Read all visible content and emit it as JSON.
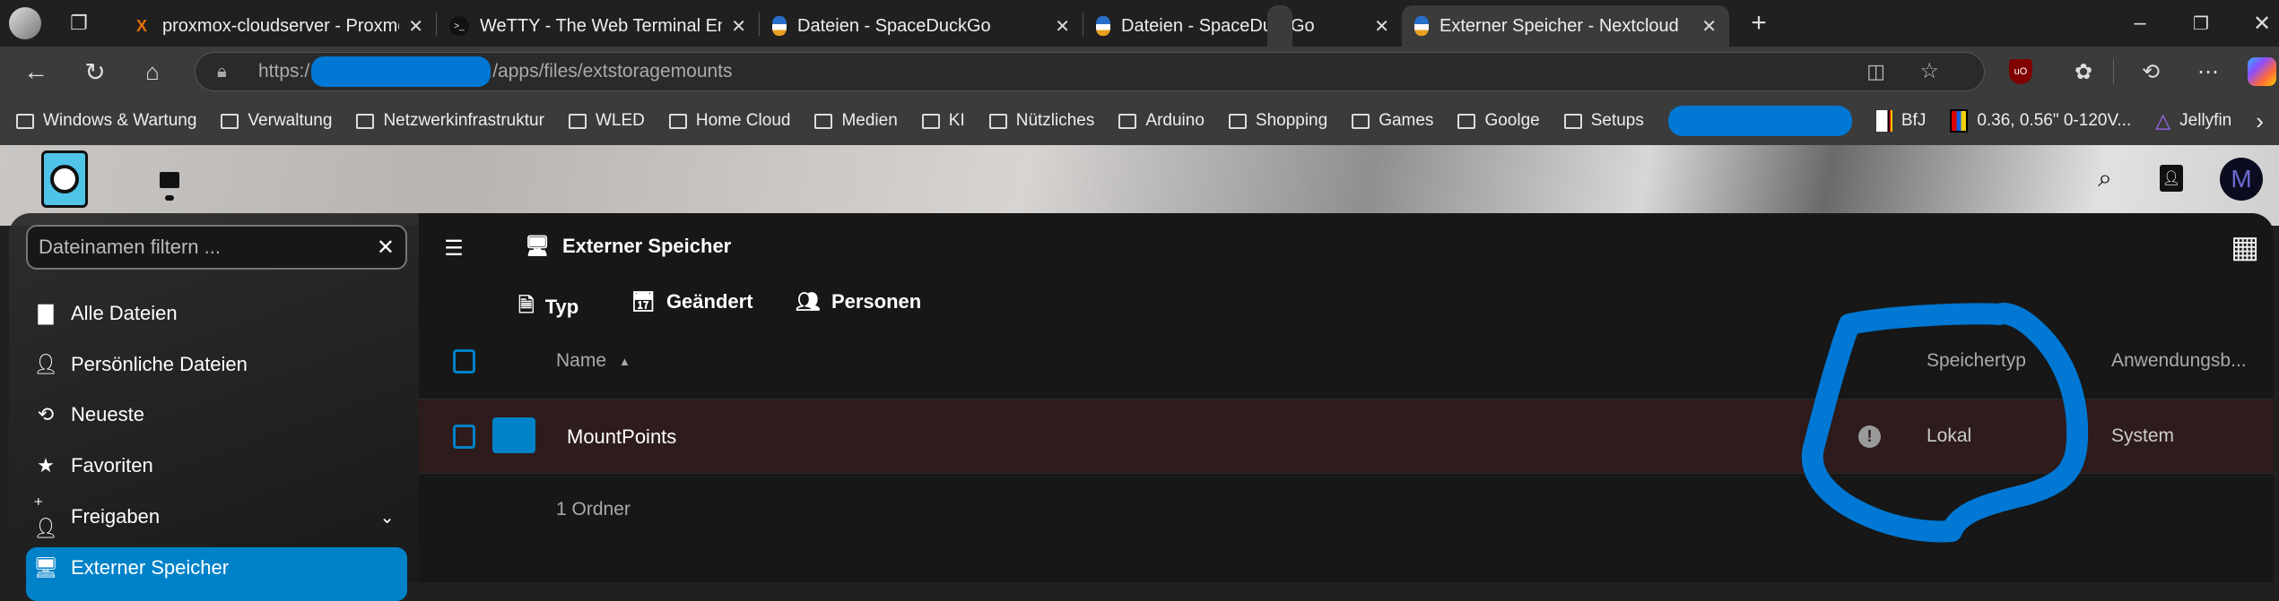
{
  "browser": {
    "tabs": [
      {
        "title": "proxmox-cloudserver - Proxmox V",
        "icon": "proxmox-icon",
        "active": false
      },
      {
        "title": "WeTTY - The Web Terminal Emula",
        "icon": "terminal-icon",
        "active": false
      },
      {
        "title": "Dateien - SpaceDuckGo",
        "icon": "duck-icon",
        "active": false
      },
      {
        "title": "Dateien - SpaceDuckGo",
        "icon": "duck-icon",
        "active": false
      },
      {
        "title": "Externer Speicher - Nextcloud",
        "icon": "duck-icon",
        "active": true
      }
    ],
    "url_prefix": "https:/",
    "url_path": "/apps/files/extstoragemounts",
    "bookmarks": [
      "Windows & Wartung",
      "Verwaltung",
      "Netzwerkinfrastruktur",
      "WLED",
      "Home Cloud",
      "Medien",
      "KI",
      "Nützliches",
      "Arduino",
      "Shopping",
      "Games",
      "Goolge",
      "Setups"
    ],
    "bookmarks_extra": [
      {
        "label": "BfJ",
        "icon": "bfj-icon"
      },
      {
        "label": "0.36, 0.56\" 0-120V...",
        "icon": "product-icon"
      },
      {
        "label": "Jellyfin",
        "icon": "jellyfin-icon"
      }
    ]
  },
  "header": {
    "avatar_letter": "M"
  },
  "sidebar": {
    "filter_placeholder": "Dateinamen filtern ...",
    "items": [
      {
        "label": "Alle Dateien"
      },
      {
        "label": "Persönliche Dateien"
      },
      {
        "label": "Neueste"
      },
      {
        "label": "Favoriten"
      },
      {
        "label": "Freigaben"
      },
      {
        "label": "Externer Speicher",
        "active": true
      }
    ]
  },
  "main": {
    "title": "Externer Speicher",
    "filters": [
      "Typ",
      "Geändert",
      "Personen"
    ],
    "columns": {
      "name": "Name",
      "storage_type": "Speichertyp",
      "scope": "Anwendungsb..."
    },
    "rows": [
      {
        "name": "MountPoints",
        "storage_type": "Lokal",
        "scope": "System",
        "status": "warning"
      }
    ],
    "summary": "1 Ordner"
  },
  "colors": {
    "accent": "#0082c9",
    "row_highlight": "#2e1b1b",
    "annotation": "#0078d4"
  }
}
